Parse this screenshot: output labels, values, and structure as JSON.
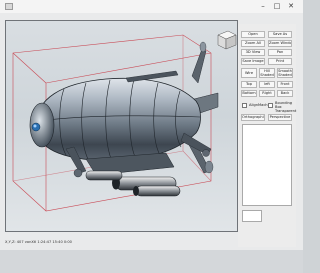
{
  "window": {
    "minimize_glyph": "–",
    "maximize_glyph": "□",
    "close_glyph": "✕",
    "icons": {
      "app": "app-icon",
      "view_cube": "view-cube-icon"
    }
  },
  "toolbar": {
    "open": "Open",
    "save_as": "Save As",
    "zoom_all": "Zoom All",
    "zoom_window": "Zoom Window",
    "view_3d": "3D View",
    "pan": "Pan",
    "save_image": "Save Image",
    "print": "Print",
    "wire": "Wire",
    "hill_shaded": "Hill Shaded",
    "smooth_shaded": "Smooth Shaded",
    "top": "Top",
    "left": "left",
    "front": "Front",
    "bottom": "Bottom",
    "right": "Right",
    "back": "Back",
    "align_machine": "AlignMachine",
    "bounding_box": "Bounding Box Transparent",
    "orthographic": "Orthographic",
    "perspective": "Perspective"
  },
  "status": {
    "text": "X,Y,Z: 407 vonXtl 1:24:47 15:40 0:00"
  },
  "colors": {
    "viewport_bg": "#d4dade",
    "bounding_box": "#c94a55",
    "hull": "#9aa6b2",
    "hull_dark": "#3c4650"
  }
}
